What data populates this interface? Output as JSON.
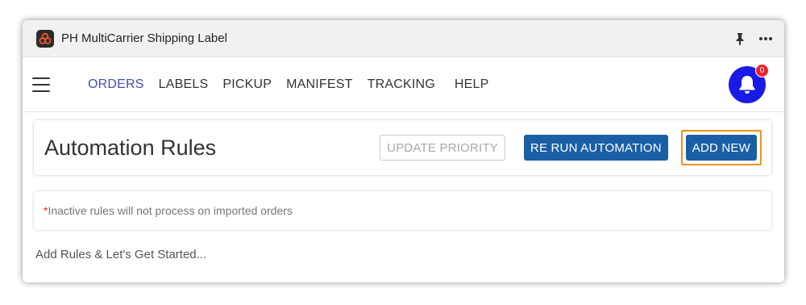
{
  "window": {
    "title": "PH MultiCarrier Shipping Label",
    "pin_icon": "pin-icon",
    "more_icon": "more-icon"
  },
  "nav": {
    "menu_icon": "hamburger-icon",
    "items": [
      "ORDERS",
      "LABELS",
      "PICKUP",
      "MANIFEST",
      "TRACKING",
      "HELP"
    ],
    "active": "ORDERS",
    "notification_count": "0"
  },
  "page": {
    "title": "Automation Rules",
    "update_priority_label": "UPDATE PRIORITY",
    "rerun_label": "RE RUN AUTOMATION",
    "add_new_label": "ADD NEW",
    "info_required_mark": "*",
    "info_text": "Inactive rules will not process on imported orders",
    "get_started": "Add Rules & Let's Get Started..."
  },
  "colors": {
    "primary": "#1a5fa6",
    "active_nav": "#3f51b5",
    "bell": "#1a1ae6",
    "badge": "#e8232a",
    "highlight": "#f0921e"
  }
}
